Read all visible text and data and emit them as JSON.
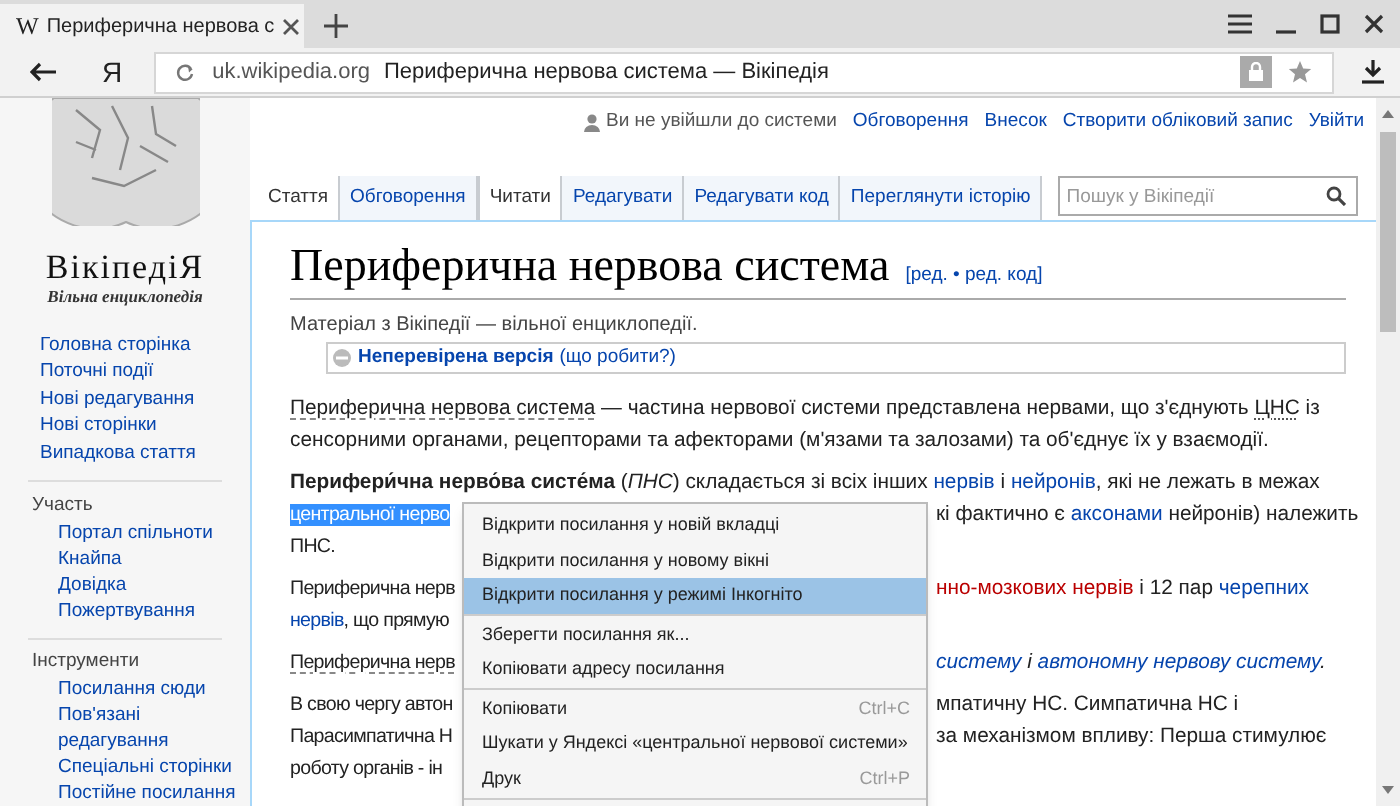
{
  "browser": {
    "tab": {
      "title": "Периферична нервова с",
      "favicon": "W"
    },
    "yandex_button": "Я",
    "address": {
      "domain": "uk.wikipedia.org",
      "title": "Периферична нервова система — Вікіпедія"
    }
  },
  "personal": {
    "status": "Ви не увійшли до системи",
    "links": [
      "Обговорення",
      "Внесок",
      "Створити обліковий запис",
      "Увійти"
    ]
  },
  "logo": {
    "wordmark": "ВікіпедіЯ",
    "tagline": "Вільна енциклопедія"
  },
  "sidebar": {
    "nav": [
      "Головна сторінка",
      "Поточні події",
      "Нові редагування",
      "Нові сторінки",
      "Випадкова стаття"
    ],
    "portals": [
      {
        "heading": "Участь",
        "items": [
          "Портал спільноти",
          "Кнайпа",
          "Довідка",
          "Пожертвування"
        ]
      },
      {
        "heading": "Інструменти",
        "items": [
          "Посилання сюди",
          "Пов'язані редагування",
          "Спеціальні сторінки",
          "Постійне посилання"
        ]
      }
    ]
  },
  "page_tabs_left": [
    {
      "label": "Стаття",
      "selected": true
    },
    {
      "label": "Обговорення",
      "selected": false
    }
  ],
  "page_tabs_right": [
    {
      "label": "Читати",
      "selected": true
    },
    {
      "label": "Редагувати",
      "selected": false
    },
    {
      "label": "Редагувати код",
      "selected": false
    },
    {
      "label": "Переглянути історію",
      "selected": false
    }
  ],
  "search": {
    "placeholder": "Пошук у Вікіпедії"
  },
  "article": {
    "title": "Периферична нервова система",
    "edit_links": "[ред. • ред. код]",
    "subtitle": "Матеріал з Вікіпедії — вільної енциклопедії.",
    "notice": {
      "label": "Неперевірена версія",
      "link": "(що робити?)"
    },
    "paragraphs": [
      {
        "lines": [
          {
            "left": [
              {
                "kind": "term",
                "text": "Периферична нервова система"
              },
              {
                "kind": "plain",
                "text": " — частина нервової системи представлена нервами, що з'єднують "
              },
              {
                "kind": "abbr",
                "text": "ЦНС"
              },
              {
                "kind": "plain",
                "text": " із"
              }
            ]
          },
          {
            "left": [
              {
                "kind": "plain",
                "text": "сенсорними органами, рецепторами та афекторами (м'язами та залозами) та об'єднує їх у взаємодії."
              }
            ]
          }
        ]
      },
      {
        "lines": [
          {
            "left": [
              {
                "kind": "bold",
                "text": "Перифери́чна нерво́ва систе́ма"
              },
              {
                "kind": "plain",
                "text": " ("
              },
              {
                "kind": "italic",
                "text": "ПНС"
              },
              {
                "kind": "plain",
                "text": ") складається зі всіх інших "
              },
              {
                "kind": "link",
                "text": "нервів"
              },
              {
                "kind": "plain",
                "text": " і "
              },
              {
                "kind": "link",
                "text": "нейронів"
              },
              {
                "kind": "plain",
                "text": ", які не лежать в межах"
              }
            ]
          },
          {
            "left": [
              {
                "kind": "selected",
                "text": "центральної нерво"
              }
            ],
            "right": [
              {
                "kind": "plain",
                "text": "кі фактично є "
              },
              {
                "kind": "link",
                "text": "аксонами"
              },
              {
                "kind": "plain",
                "text": " нейронів) належить"
              }
            ]
          },
          {
            "left": [
              {
                "kind": "plain",
                "text": "ПНС."
              }
            ]
          }
        ]
      },
      {
        "lines": [
          {
            "left": [
              {
                "kind": "plain",
                "text": "Периферична нерв"
              }
            ],
            "right": [
              {
                "kind": "red_link",
                "text": "нно-мозкових нервів"
              },
              {
                "kind": "plain",
                "text": " і 12 пар "
              },
              {
                "kind": "link",
                "text": "черепних"
              }
            ]
          },
          {
            "left": [
              {
                "kind": "link",
                "text": "нервів"
              },
              {
                "kind": "plain",
                "text": ", що прямую"
              }
            ]
          }
        ]
      },
      {
        "lines": [
          {
            "left": [
              {
                "kind": "term",
                "text": "Периферична нерв"
              }
            ],
            "right": [
              {
                "kind": "italic_link",
                "text": "систему"
              },
              {
                "kind": "italic",
                "text": " і "
              },
              {
                "kind": "italic_link",
                "text": "автономну нервову систему"
              },
              {
                "kind": "italic",
                "text": "."
              }
            ]
          }
        ]
      },
      {
        "lines": [
          {
            "left": [
              {
                "kind": "plain",
                "text": "В свою чергу автон"
              }
            ],
            "right": [
              {
                "kind": "plain",
                "text": "мпатичну НС. Симпатична НС і"
              }
            ]
          },
          {
            "left": [
              {
                "kind": "plain",
                "text": "Парасимпатична Н"
              }
            ],
            "right": [
              {
                "kind": "plain",
                "text": "за механізмом впливу: Перша стимулює"
              }
            ]
          },
          {
            "left": [
              {
                "kind": "plain",
                "text": "роботу органів - ін"
              }
            ]
          }
        ]
      }
    ]
  },
  "context_menu": {
    "groups": [
      [
        {
          "label": "Відкрити посилання у новій вкладці",
          "selected": false
        },
        {
          "label": "Відкрити посилання у новому вікні",
          "selected": false
        },
        {
          "label": "Відкрити посилання у режимі Інкогніто",
          "selected": true
        }
      ],
      [
        {
          "label": "Зберегти посилання як...",
          "selected": false
        },
        {
          "label": "Копіювати адресу посилання",
          "selected": false
        }
      ],
      [
        {
          "label": "Копіювати",
          "shortcut": "Ctrl+C",
          "selected": false
        },
        {
          "label": "Шукати у Яндексі «центральної нервової системи»",
          "selected": false
        },
        {
          "label": "Друк",
          "shortcut": "Ctrl+P",
          "selected": false
        }
      ]
    ]
  }
}
